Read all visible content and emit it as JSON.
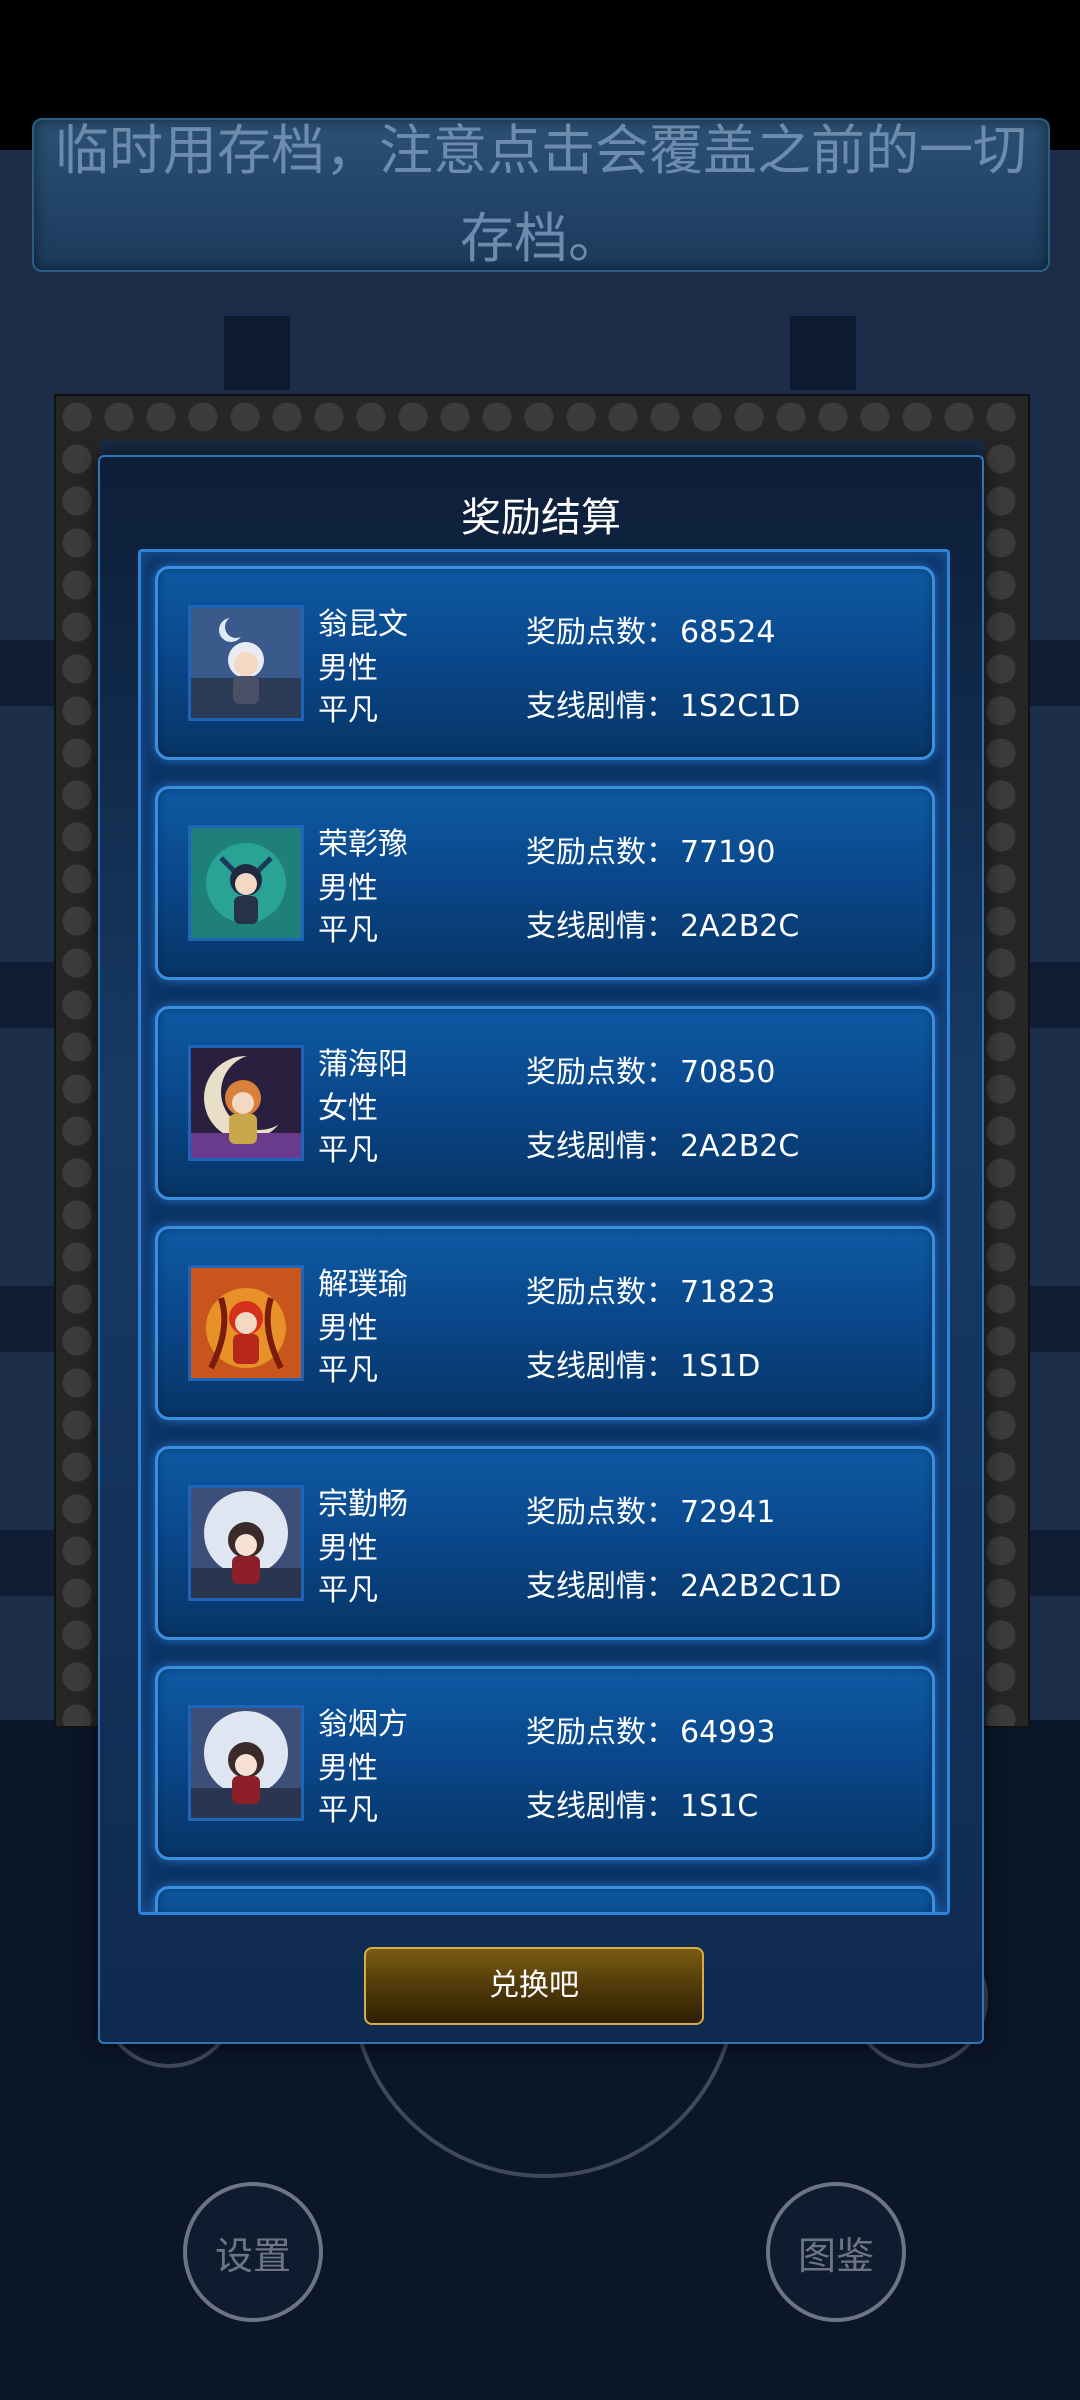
{
  "notice": {
    "text": "临时用存档，注意点击会覆盖之前的一切存档。"
  },
  "modal": {
    "title": "奖励结算",
    "points_label": "奖励点数：",
    "branch_label": "支线剧情：",
    "redeem_label": "兑换吧"
  },
  "rewards": [
    {
      "name": "翁昆文",
      "gender": "男性",
      "rank": "平凡",
      "points": "68524",
      "branch": "1S2C1D",
      "avatar": "white-haired-knight-avatar"
    },
    {
      "name": "荣彰豫",
      "gender": "男性",
      "rank": "平凡",
      "points": "77190",
      "branch": "2A2B2C",
      "avatar": "dragon-boy-avatar"
    },
    {
      "name": "蒲海阳",
      "gender": "女性",
      "rank": "平凡",
      "points": "70850",
      "branch": "2A2B2C",
      "avatar": "moon-girl-avatar"
    },
    {
      "name": "解璞瑜",
      "gender": "男性",
      "rank": "平凡",
      "points": "71823",
      "branch": "1S1D",
      "avatar": "fire-spirit-avatar"
    },
    {
      "name": "宗勤畅",
      "gender": "男性",
      "rank": "平凡",
      "points": "72941",
      "branch": "2A2B2C1D",
      "avatar": "horned-girl-avatar"
    },
    {
      "name": "翁烟方",
      "gender": "男性",
      "rank": "平凡",
      "points": "64993",
      "branch": "1S1C",
      "avatar": "horned-girl-avatar"
    }
  ],
  "bottom_buttons": {
    "settings": "设置",
    "codex": "图鉴"
  }
}
